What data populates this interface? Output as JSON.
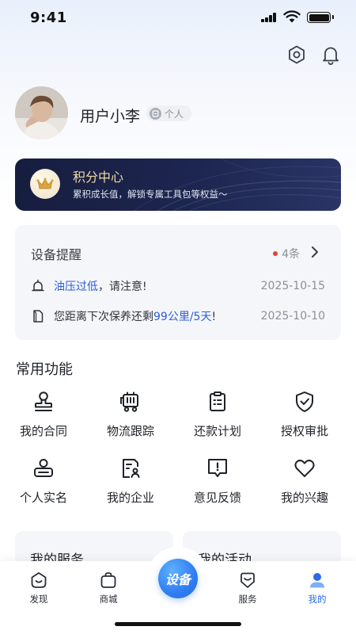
{
  "status_bar": {
    "time": "9:41"
  },
  "profile": {
    "username": "用户小李",
    "tag": "个人"
  },
  "points": {
    "title": "积分中心",
    "subtitle": "累积成长值，解锁专属工具包等权益～"
  },
  "reminder": {
    "title": "设备提醒",
    "count": "4条",
    "items": [
      {
        "highlight": "油压过低",
        "text": "，请注意!",
        "date": "2025-10-15"
      },
      {
        "prefix": "您距离下次保养还剩",
        "highlight": "99公里/5天",
        "suffix": "!",
        "date": "2025-10-10"
      }
    ]
  },
  "functions": {
    "title": "常用功能",
    "items": [
      {
        "label": "我的合同",
        "icon": "seal-stamp-icon"
      },
      {
        "label": "物流跟踪",
        "icon": "truck-icon"
      },
      {
        "label": "还款计划",
        "icon": "clipboard-icon"
      },
      {
        "label": "授权审批",
        "icon": "shield-check-icon"
      },
      {
        "label": "个人实名",
        "icon": "id-person-icon"
      },
      {
        "label": "我的企业",
        "icon": "company-doc-icon"
      },
      {
        "label": "意见反馈",
        "icon": "feedback-icon"
      },
      {
        "label": "我的兴趣",
        "icon": "heart-icon"
      }
    ]
  },
  "cards": {
    "left": "我的服务",
    "right": "我的活动"
  },
  "tabbar": {
    "items": [
      {
        "label": "发现",
        "icon": "discover-icon"
      },
      {
        "label": "商城",
        "icon": "shopping-bag-icon"
      },
      {
        "label": "服务",
        "icon": "service-icon"
      },
      {
        "label": "我的",
        "icon": "user-icon"
      }
    ],
    "center_label": "设备",
    "active_color": "#2c6bea"
  },
  "colors": {
    "accent": "#2c5dd6",
    "badge_dot": "#e5413a",
    "banner_gold": "#f2d9a4",
    "banner_bg": "#1d2650"
  }
}
